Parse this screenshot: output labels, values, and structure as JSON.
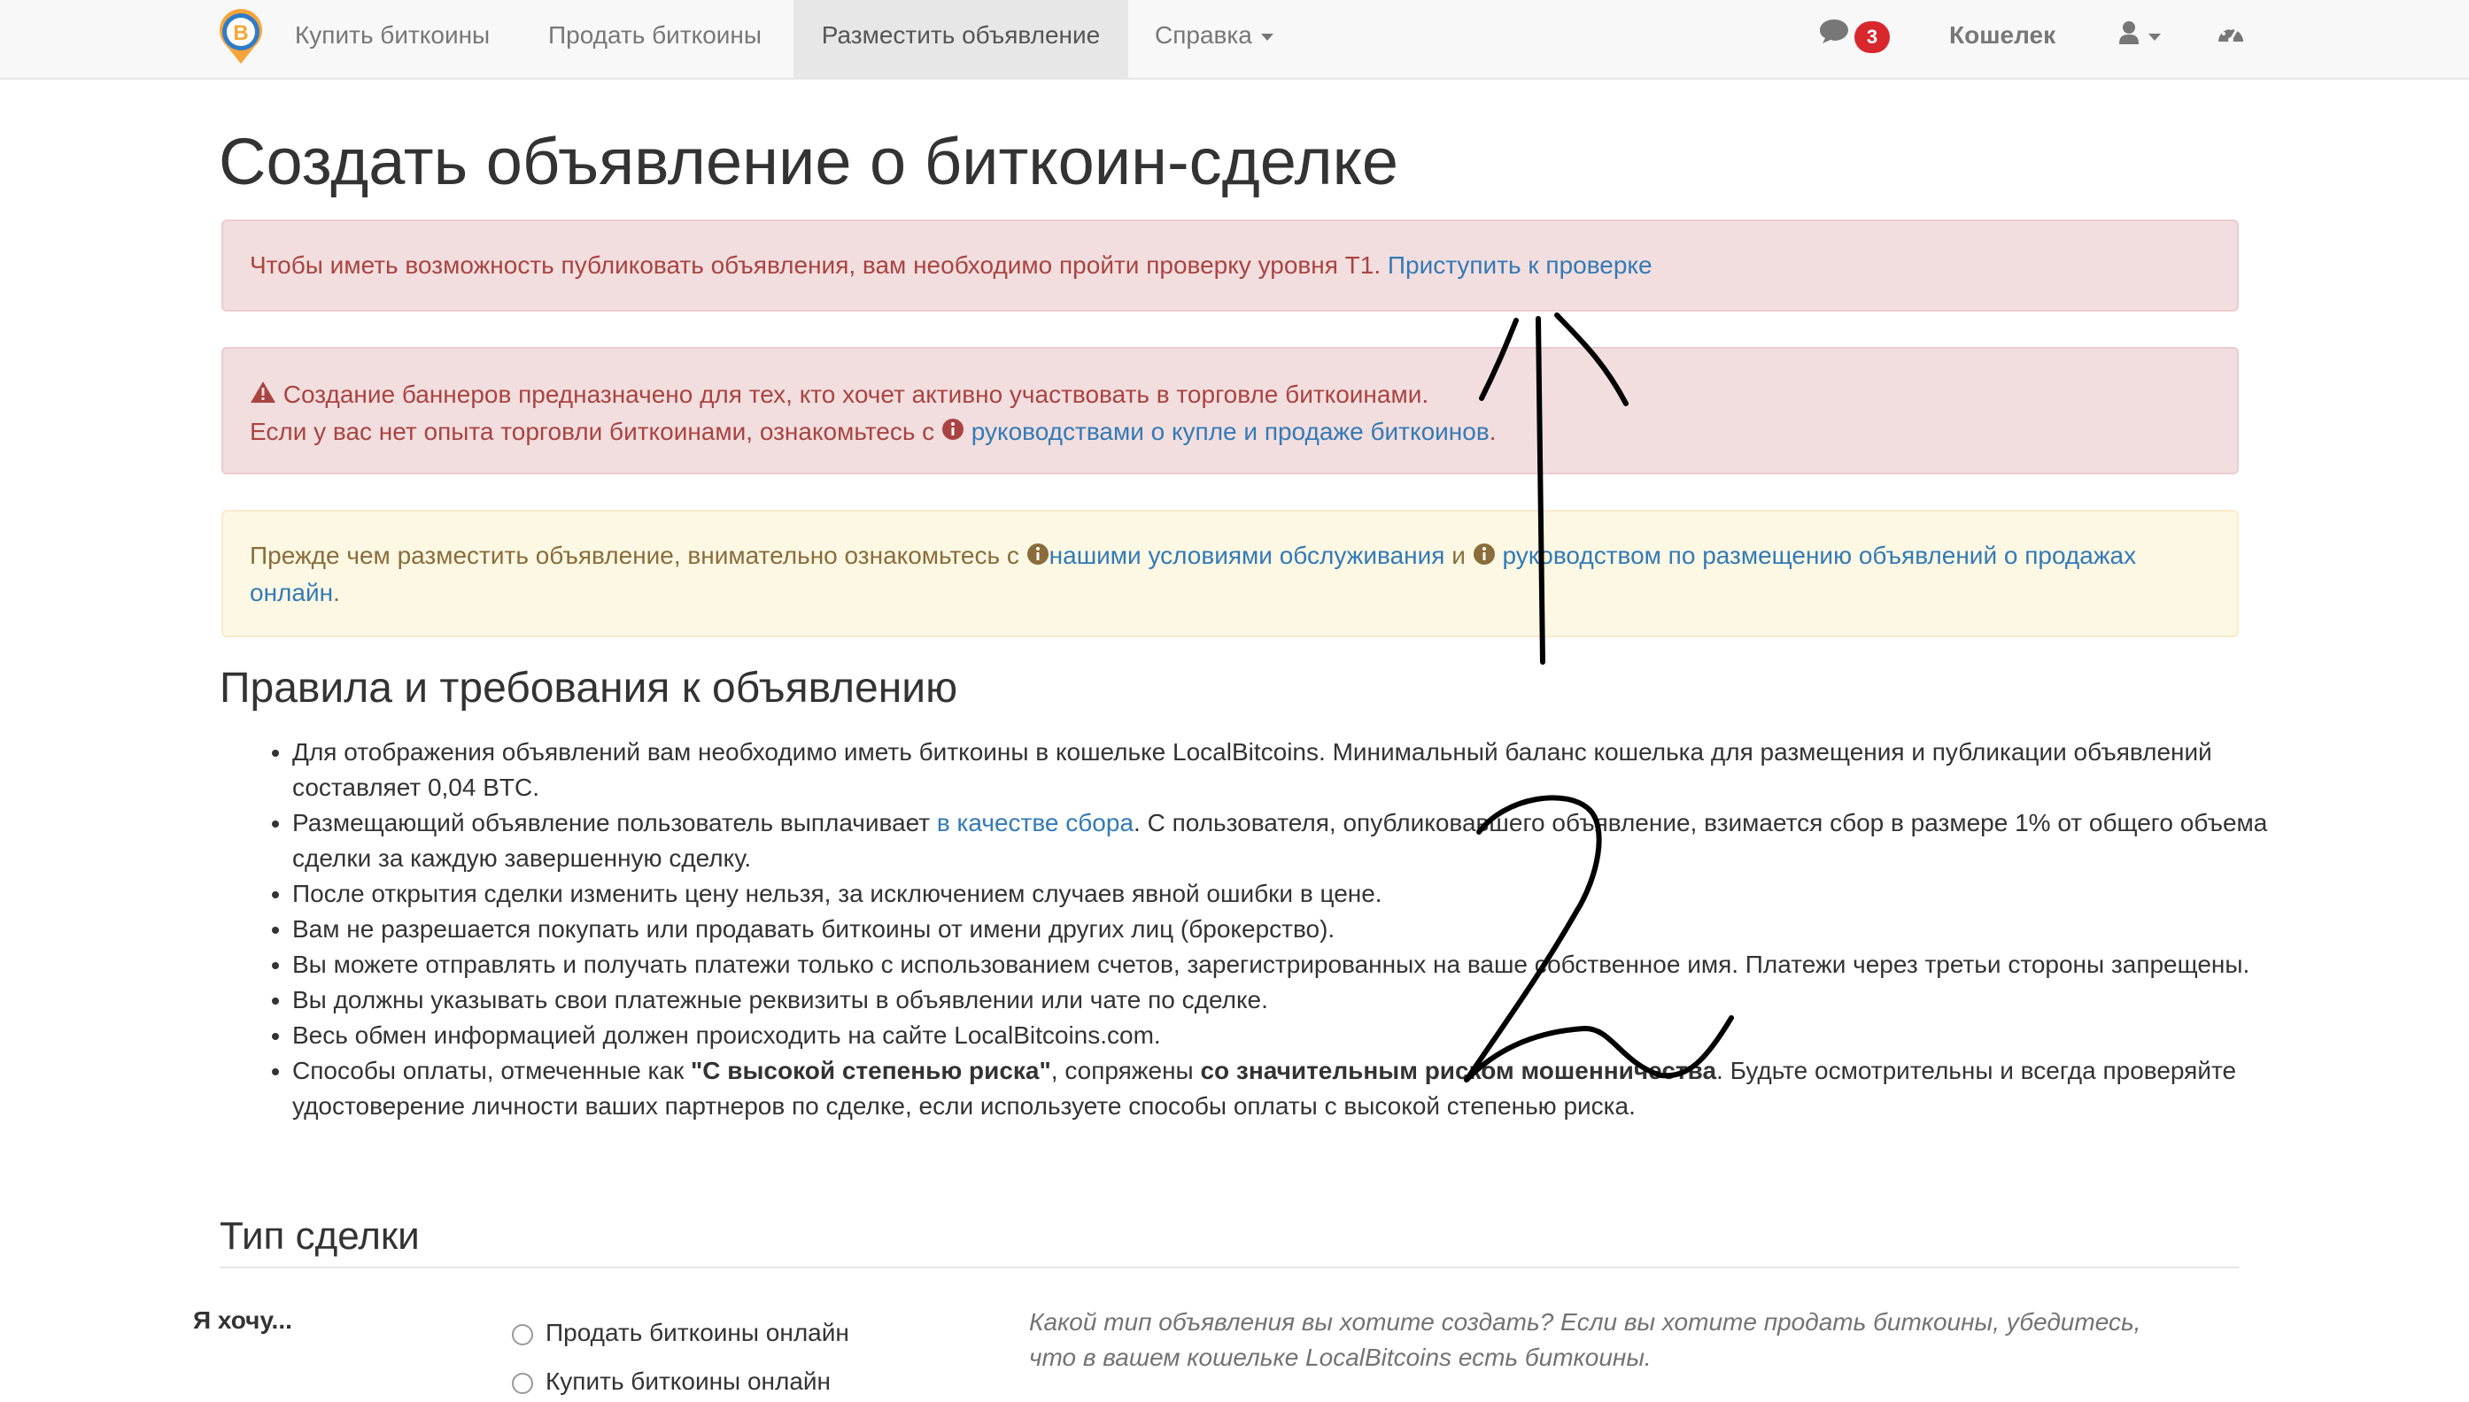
{
  "navbar": {
    "buy": "Купить биткоины",
    "sell": "Продать биткоины",
    "post_ad": "Разместить объявление",
    "help": "Справка",
    "messages_count": "3",
    "wallet": "Кошелек",
    "logo_letter": "B",
    "accent_color": "#d9272e"
  },
  "page": {
    "title": "Создать объявление о биткоин-сделке"
  },
  "alerts": {
    "verification": {
      "text": "Чтобы иметь возможность публиковать объявления, вам необходимо пройти проверку уровня T1. ",
      "link": "Приступить к проверке"
    },
    "banners": {
      "line1": "Создание баннеров предназначено для тех, кто хочет активно участвовать в торговле биткоинами.",
      "line2_text": "Если у вас нет опыта торговли биткоинами, ознакомьтесь с ",
      "line2_link": "руководствами о купле и продаже биткоинов",
      "line2_end": "."
    },
    "terms": {
      "text1": "Прежде чем разместить объявление, внимательно ознакомьтесь с ",
      "link1": "нашими условиями обслуживания",
      "text2": " и ",
      "link2": "руководством по размещению объявлений о продажах онлайн",
      "end": "."
    }
  },
  "rules": {
    "heading": "Правила и требования к объявлению",
    "item1": "Для отображения объявлений вам необходимо иметь биткоины в кошельке LocalBitcoins. Минимальный баланс кошелька для размещения и публикации объявлений составляет 0,04 BTC.",
    "item2_a": "Размещающий объявление пользователь выплачивает ",
    "item2_link": "в качестве сбора",
    "item2_b": ". С пользователя, опубликовавшего объявление, взимается сбор в размере 1% от общего объема сделки за каждую завершенную сделку.",
    "item3": "После открытия сделки изменить цену нельзя, за исключением случаев явной ошибки в цене.",
    "item4": "Вам не разрешается покупать или продавать биткоины от имени других лиц (брокерство).",
    "item5": "Вы можете отправлять и получать платежи только с использованием счетов, зарегистрированных на ваше собственное имя. Платежи через третьи стороны запрещены.",
    "item6": "Вы должны указывать свои платежные реквизиты в объявлении или чате по сделке.",
    "item7": "Весь обмен информацией должен происходить на сайте LocalBitcoins.com.",
    "item8_a": "Способы оплаты, отмеченные как ",
    "item8_b": "\"С высокой степенью риска\"",
    "item8_c": ", сопряжены ",
    "item8_d": "со значительным риском мошенничества",
    "item8_e": ". Будьте осмотрительны и всегда проверяйте удостоверение личности ваших партнеров по сделке, если используете способы оплаты с высокой степенью риска."
  },
  "trade_type": {
    "heading": "Тип сделки",
    "label": "Я хочу...",
    "option_sell": "Продать биткоины онлайн",
    "option_buy": "Купить биткоины онлайн",
    "help": "Какой тип объявления вы хотите создать? Если вы хотите продать биткоины, убедитесь, что в вашем кошельке LocalBitcoins есть биткоины."
  },
  "annotation": {
    "label": "2",
    "color": "#000000"
  }
}
